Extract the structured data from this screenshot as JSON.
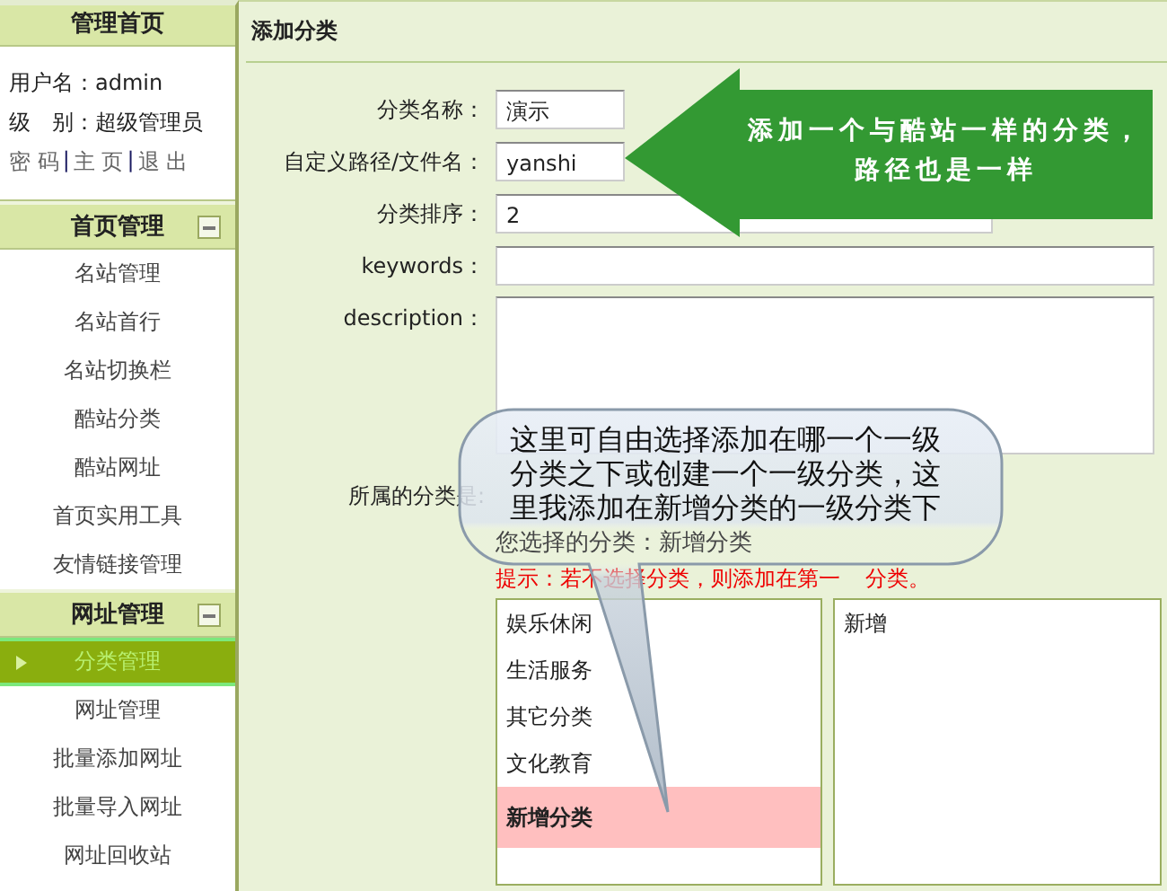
{
  "sidebar": {
    "title": "管理首页",
    "user_lines": [
      "用户名：admin",
      "级　别：超级管理员"
    ],
    "links": [
      {
        "kind": "link",
        "text": "密 码"
      },
      {
        "kind": "separator",
        "text": "|"
      },
      {
        "kind": "link",
        "text": "主 页"
      },
      {
        "kind": "separator",
        "text": "|"
      },
      {
        "kind": "link",
        "text": "退 出"
      }
    ],
    "sections": [
      {
        "title": "首页管理",
        "expanded": true,
        "items": [
          {
            "label": "名站管理",
            "selected": false
          },
          {
            "label": "名站首行",
            "selected": false
          },
          {
            "label": "名站切换栏",
            "selected": false
          },
          {
            "label": "酷站分类",
            "selected": false
          },
          {
            "label": "酷站网址",
            "selected": false
          },
          {
            "label": "首页实用工具",
            "selected": false
          },
          {
            "label": "友情链接管理",
            "selected": false
          }
        ]
      },
      {
        "title": "网址管理",
        "expanded": true,
        "items": [
          {
            "label": "分类管理",
            "selected": true
          },
          {
            "label": "网址管理",
            "selected": false
          },
          {
            "label": "批量添加网址",
            "selected": false
          },
          {
            "label": "批量导入网址",
            "selected": false
          },
          {
            "label": "网址回收站",
            "selected": false
          }
        ]
      }
    ]
  },
  "panel": {
    "title": "添加分类",
    "fields": [
      {
        "kind": "input",
        "label": "分类名称：",
        "value": "演示"
      },
      {
        "kind": "input",
        "label": "自定义路径/文件名：",
        "value": "yanshi"
      },
      {
        "kind": "input",
        "label": "分类排序：",
        "value": "2"
      },
      {
        "kind": "wide",
        "label": "keywords："
      },
      {
        "kind": "textarea",
        "label": "description："
      }
    ],
    "category_label": "所属的分类是:",
    "selected_category": "您选择的分类：新增分类",
    "hint_parts": [
      "提示：若不选择分类，则添加在第一",
      "分类。"
    ],
    "category_lists": [
      {
        "items": [
          {
            "label": "娱乐休闲",
            "selected": false
          },
          {
            "label": "生活服务",
            "selected": false
          },
          {
            "label": "其它分类",
            "selected": false
          },
          {
            "label": "文化教育",
            "selected": false
          },
          {
            "label": "新增分类",
            "selected": true
          }
        ]
      },
      {
        "items": [
          {
            "label": "新增",
            "selected": false
          }
        ]
      }
    ]
  },
  "annotations": [
    {
      "kind": "arrow",
      "text": "添加一个与酷站一样的分类，路径也是一样"
    },
    {
      "kind": "callout",
      "text": "这里可自由选择添加在哪一个一级分类之下或创建一个一级分类，这里我添加在新增分类的一级分类下"
    }
  ]
}
